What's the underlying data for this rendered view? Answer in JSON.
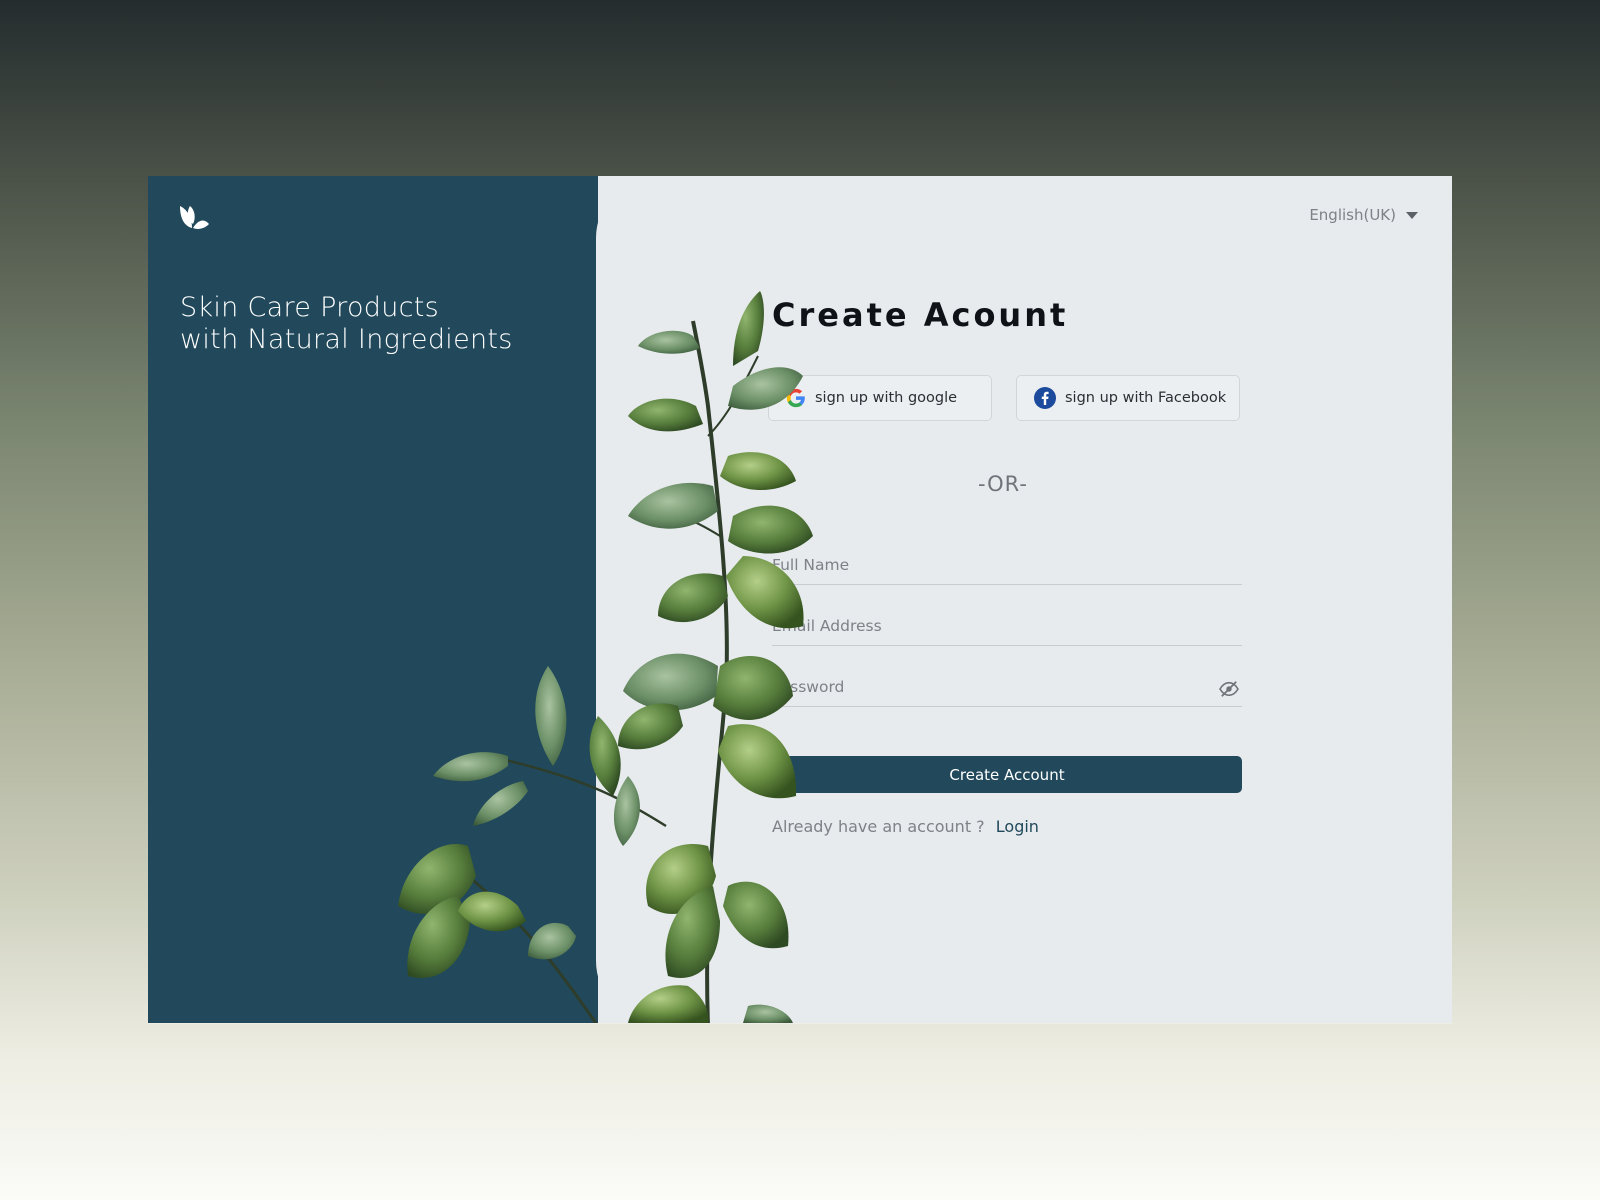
{
  "brand": {
    "tagline_line1": "Skin Care Products",
    "tagline_line2": "with Natural Ingredients",
    "logo_icon": "leaf-logo-icon"
  },
  "header": {
    "language_selected": "English(UK)"
  },
  "form": {
    "title": "Create Acount",
    "google_label": "sign up with google",
    "facebook_label": "sign up with Facebook",
    "divider_text": "-OR-",
    "full_name_placeholder": "Full Name",
    "email_placeholder": "Email Address",
    "password_placeholder": "Password",
    "submit_label": "Create Account",
    "login_prompt": "Already have an account ?",
    "login_link": "Login"
  },
  "colors": {
    "primary": "#21495b",
    "panel_bg": "#e8ebee",
    "google_blue": "#4285F4",
    "google_red": "#EA4335",
    "google_yellow": "#FBBC05",
    "google_green": "#34A853",
    "facebook_blue": "#1c4a9c"
  },
  "icons": {
    "language_caret": "chevron-down-icon",
    "password_toggle": "eye-off-icon"
  }
}
